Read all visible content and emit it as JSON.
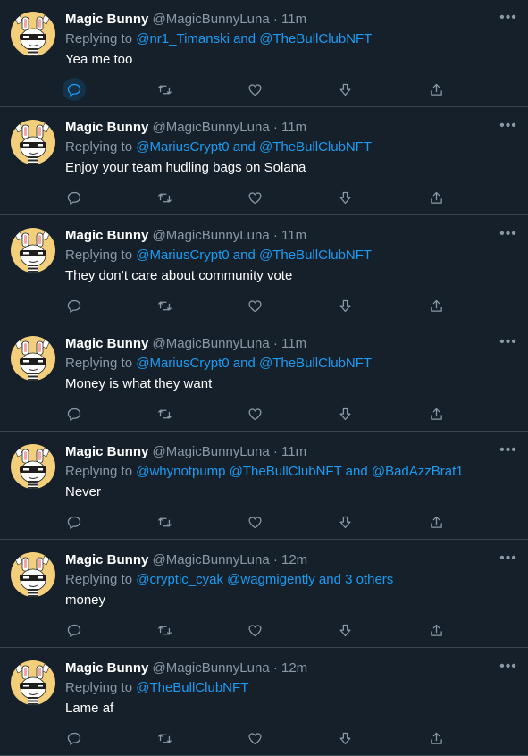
{
  "tweets": [
    {
      "name": "Magic Bunny",
      "handle": "@MagicBunnyLuna",
      "dot": "·",
      "time": "11m",
      "replying": "Replying to",
      "mentions": "@nr1_Timanski and @TheBullClubNFT",
      "text": "Yea me too"
    },
    {
      "name": "Magic Bunny",
      "handle": "@MagicBunnyLuna",
      "dot": "·",
      "time": "11m",
      "replying": "Replying to",
      "mentions": "@MariusCrypt0 and @TheBullClubNFT",
      "text": "Enjoy your team hudling bags on Solana"
    },
    {
      "name": "Magic Bunny",
      "handle": "@MagicBunnyLuna",
      "dot": "·",
      "time": "11m",
      "replying": "Replying to",
      "mentions": "@MariusCrypt0 and @TheBullClubNFT",
      "text": "They don’t care about community vote"
    },
    {
      "name": "Magic Bunny",
      "handle": "@MagicBunnyLuna",
      "dot": "·",
      "time": "11m",
      "replying": "Replying to",
      "mentions": "@MariusCrypt0 and @TheBullClubNFT",
      "text": "Money is what they want"
    },
    {
      "name": "Magic Bunny",
      "handle": "@MagicBunnyLuna",
      "dot": "·",
      "time": "11m",
      "replying": "Replying to",
      "mentions": "@whynotpump @TheBullClubNFT and @BadAzzBrat1",
      "text": "Never"
    },
    {
      "name": "Magic Bunny",
      "handle": "@MagicBunnyLuna",
      "dot": "·",
      "time": "12m",
      "replying": "Replying to",
      "mentions": "@cryptic_cyak @wagmigently and 3 others",
      "text": "money"
    },
    {
      "name": "Magic Bunny",
      "handle": "@MagicBunnyLuna",
      "dot": "·",
      "time": "12m",
      "replying": "Replying to",
      "mentions": "@TheBullClubNFT",
      "text": "Lame af"
    }
  ],
  "more_glyph": "•••",
  "icons": {
    "reply": "reply-icon",
    "retweet": "retweet-icon",
    "like": "heart-icon",
    "vote": "arrow-down-icon",
    "share": "share-icon",
    "more": "more-icon"
  },
  "colors": {
    "background": "#15202b",
    "border": "#38444d",
    "accent": "#1d9bf0",
    "secondary_text": "#8b98a5",
    "avatar_bg": "#f3cf7c"
  }
}
